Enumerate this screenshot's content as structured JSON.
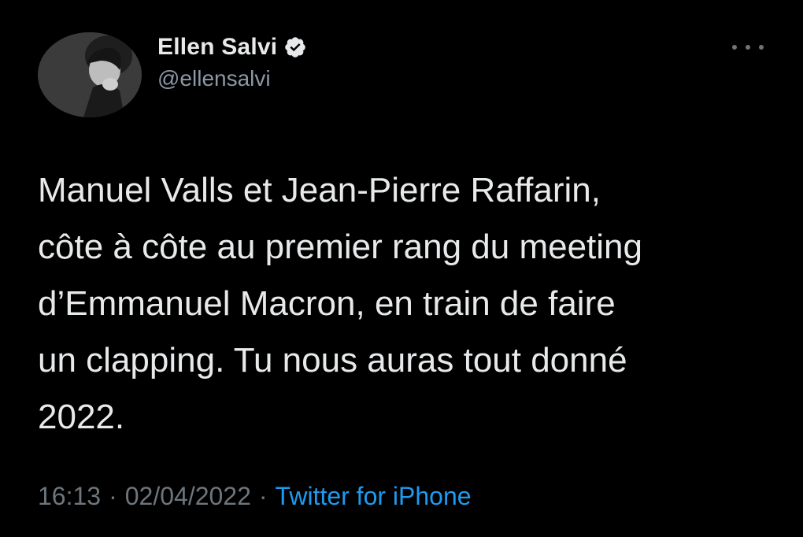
{
  "author": {
    "display_name": "Ellen Salvi",
    "handle": "@ellensalvi",
    "verified": true,
    "avatar_icon": "profile-photo"
  },
  "menu": {
    "icon": "more-horizontal-icon"
  },
  "tweet": {
    "text": "Manuel Valls et Jean-Pierre Raffarin,\ncôte à côte au premier rang du meeting\nd’Emmanuel Macron, en train de faire\nun clapping. Tu nous auras tout donné\n2022."
  },
  "meta": {
    "time": "16:13",
    "separator": "·",
    "date": "02/04/2022",
    "source": "Twitter for iPhone"
  },
  "colors": {
    "background": "#000000",
    "text": "#e7e9ea",
    "secondary": "#6e767d",
    "link": "#1d9bf0"
  }
}
